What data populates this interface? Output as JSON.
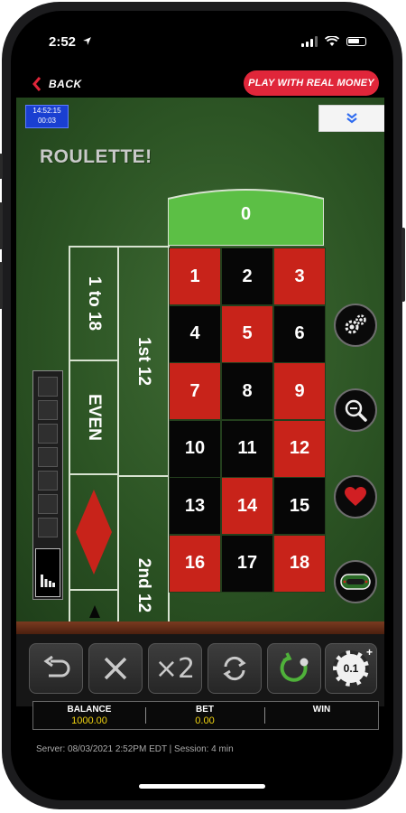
{
  "status_bar": {
    "time": "2:52",
    "location_icon": "location-arrow-icon",
    "signal_icon": "cellular-signal-icon",
    "wifi_icon": "wifi-icon",
    "battery_icon": "battery-icon"
  },
  "nav": {
    "back_label": "BACK",
    "real_money_label": "PLAY WITH REAL MONEY"
  },
  "game": {
    "clock_time": "14:52:15",
    "clock_elapsed": "00:03",
    "title": "ROULETTE!",
    "zero_label": "0",
    "outside": {
      "low": "1 to 18",
      "even": "EVEN",
      "dozen1": "1st 12",
      "dozen2": "2nd 12"
    },
    "numbers": [
      {
        "n": "1",
        "c": "red"
      },
      {
        "n": "2",
        "c": "black"
      },
      {
        "n": "3",
        "c": "red"
      },
      {
        "n": "4",
        "c": "black"
      },
      {
        "n": "5",
        "c": "red"
      },
      {
        "n": "6",
        "c": "black"
      },
      {
        "n": "7",
        "c": "red"
      },
      {
        "n": "8",
        "c": "black"
      },
      {
        "n": "9",
        "c": "red"
      },
      {
        "n": "10",
        "c": "black"
      },
      {
        "n": "11",
        "c": "black"
      },
      {
        "n": "12",
        "c": "red"
      },
      {
        "n": "13",
        "c": "black"
      },
      {
        "n": "14",
        "c": "red"
      },
      {
        "n": "15",
        "c": "black"
      },
      {
        "n": "16",
        "c": "red"
      },
      {
        "n": "17",
        "c": "black"
      },
      {
        "n": "18",
        "c": "red"
      }
    ],
    "side_buttons": [
      "settings-gears-icon",
      "zoom-magnifier-icon",
      "favorites-heart-icon",
      "racetrack-icon"
    ]
  },
  "controls": {
    "buttons": [
      "undo-icon",
      "clear-x-icon",
      "double-x2-icon",
      "rebet-refresh-icon",
      "spin-icon",
      "chip-value-icon"
    ],
    "double_label": "×2",
    "chip_label": "0.1"
  },
  "info": {
    "balance_label": "BALANCE",
    "balance_value": "1000.00",
    "bet_label": "BET",
    "bet_value": "0.00",
    "win_label": "WIN",
    "win_value": ""
  },
  "footer": {
    "server_text": "Server: 08/03/2021 2:52PM EDT  |  Session: 4 min"
  },
  "colors": {
    "felt": "#2c5424",
    "red": "#c8231a",
    "black": "#060606",
    "zero_green": "#5cbf45",
    "accent": "#e0263a",
    "value_yellow": "#f2d410"
  }
}
